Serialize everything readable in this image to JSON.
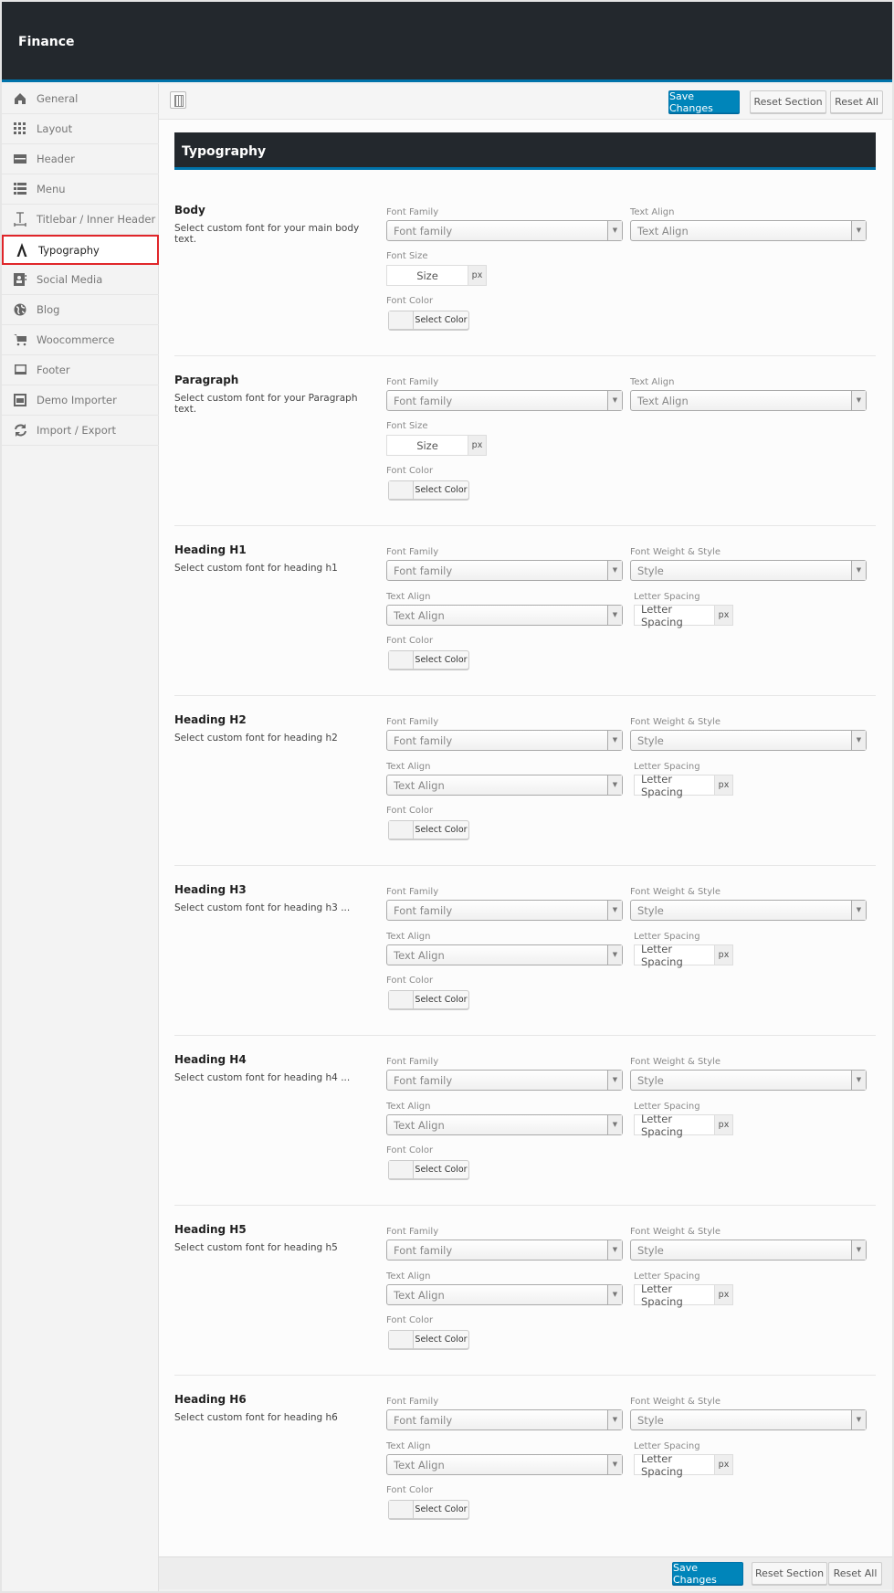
{
  "app_title": "Finance",
  "toolbar": {
    "save_label": "Save Changes",
    "reset_section_label": "Reset Section",
    "reset_all_label": "Reset All"
  },
  "sidebar": {
    "items": [
      {
        "label": "General",
        "icon": "home-icon"
      },
      {
        "label": "Layout",
        "icon": "grid-icon"
      },
      {
        "label": "Header",
        "icon": "header-icon"
      },
      {
        "label": "Menu",
        "icon": "list-icon"
      },
      {
        "label": "Titlebar / Inner Header",
        "icon": "text-cursor-icon"
      },
      {
        "label": "Typography",
        "icon": "font-icon",
        "active": true
      },
      {
        "label": "Social Media",
        "icon": "contact-card-icon"
      },
      {
        "label": "Blog",
        "icon": "globe-icon"
      },
      {
        "label": "Woocommerce",
        "icon": "cart-icon"
      },
      {
        "label": "Footer",
        "icon": "laptop-icon"
      },
      {
        "label": "Demo Importer",
        "icon": "window-icon"
      },
      {
        "label": "Import / Export",
        "icon": "refresh-icon"
      }
    ]
  },
  "section_title": "Typography",
  "accent_color": "#0085ba",
  "sections": [
    {
      "kind": "basic",
      "title": "Body",
      "desc": "Select custom font for your main body text.",
      "font_family_label": "Font Family",
      "font_family_value": "Font family",
      "text_align_label": "Text Align",
      "text_align_value": "Text Align",
      "font_size_label": "Font Size",
      "font_size_placeholder": "Size",
      "unit": "px",
      "font_color_label": "Font Color",
      "color_button": "Select Color"
    },
    {
      "kind": "basic",
      "title": "Paragraph",
      "desc": "Select custom font for your Paragraph text.",
      "font_family_label": "Font Family",
      "font_family_value": "Font family",
      "text_align_label": "Text Align",
      "text_align_value": "Text Align",
      "font_size_label": "Font Size",
      "font_size_placeholder": "Size",
      "unit": "px",
      "font_color_label": "Font Color",
      "color_button": "Select Color"
    },
    {
      "kind": "heading",
      "title": "Heading H1",
      "desc": "Select custom font for heading h1",
      "font_family_label": "Font Family",
      "font_family_value": "Font family",
      "weight_label": "Font Weight & Style",
      "weight_value": "Style",
      "text_align_label": "Text Align",
      "text_align_value": "Text Align",
      "letter_spacing_label": "Letter Spacing",
      "letter_spacing_placeholder": "Letter Spacing",
      "unit": "px",
      "font_color_label": "Font Color",
      "color_button": "Select Color"
    },
    {
      "kind": "heading",
      "title": "Heading H2",
      "desc": "Select custom font for heading h2",
      "font_family_label": "Font Family",
      "font_family_value": "Font family",
      "weight_label": "Font Weight & Style",
      "weight_value": "Style",
      "text_align_label": "Text Align",
      "text_align_value": "Text Align",
      "letter_spacing_label": "Letter Spacing",
      "letter_spacing_placeholder": "Letter Spacing",
      "unit": "px",
      "font_color_label": "Font Color",
      "color_button": "Select Color"
    },
    {
      "kind": "heading",
      "title": "Heading H3",
      "desc": "Select custom font for heading h3 ...",
      "font_family_label": "Font Family",
      "font_family_value": "Font family",
      "weight_label": "Font Weight & Style",
      "weight_value": "Style",
      "text_align_label": "Text Align",
      "text_align_value": "Text Align",
      "letter_spacing_label": "Letter Spacing",
      "letter_spacing_placeholder": "Letter Spacing",
      "unit": "px",
      "font_color_label": "Font Color",
      "color_button": "Select Color"
    },
    {
      "kind": "heading",
      "title": "Heading H4",
      "desc": "Select custom font for heading h4 ...",
      "font_family_label": "Font Family",
      "font_family_value": "Font family",
      "weight_label": "Font Weight & Style",
      "weight_value": "Style",
      "text_align_label": "Text Align",
      "text_align_value": "Text Align",
      "letter_spacing_label": "Letter Spacing",
      "letter_spacing_placeholder": "Letter Spacing",
      "unit": "px",
      "font_color_label": "Font Color",
      "color_button": "Select Color"
    },
    {
      "kind": "heading",
      "title": "Heading H5",
      "desc": "Select custom font for heading h5",
      "font_family_label": "Font Family",
      "font_family_value": "Font family",
      "weight_label": "Font Weight & Style",
      "weight_value": "Style",
      "text_align_label": "Text Align",
      "text_align_value": "Text Align",
      "letter_spacing_label": "Letter Spacing",
      "letter_spacing_placeholder": "Letter Spacing",
      "unit": "px",
      "font_color_label": "Font Color",
      "color_button": "Select Color"
    },
    {
      "kind": "heading",
      "title": "Heading H6",
      "desc": "Select custom font for heading h6",
      "font_family_label": "Font Family",
      "font_family_value": "Font family",
      "weight_label": "Font Weight & Style",
      "weight_value": "Style",
      "text_align_label": "Text Align",
      "text_align_value": "Text Align",
      "letter_spacing_label": "Letter Spacing",
      "letter_spacing_placeholder": "Letter Spacing",
      "unit": "px",
      "font_color_label": "Font Color",
      "color_button": "Select Color"
    }
  ]
}
